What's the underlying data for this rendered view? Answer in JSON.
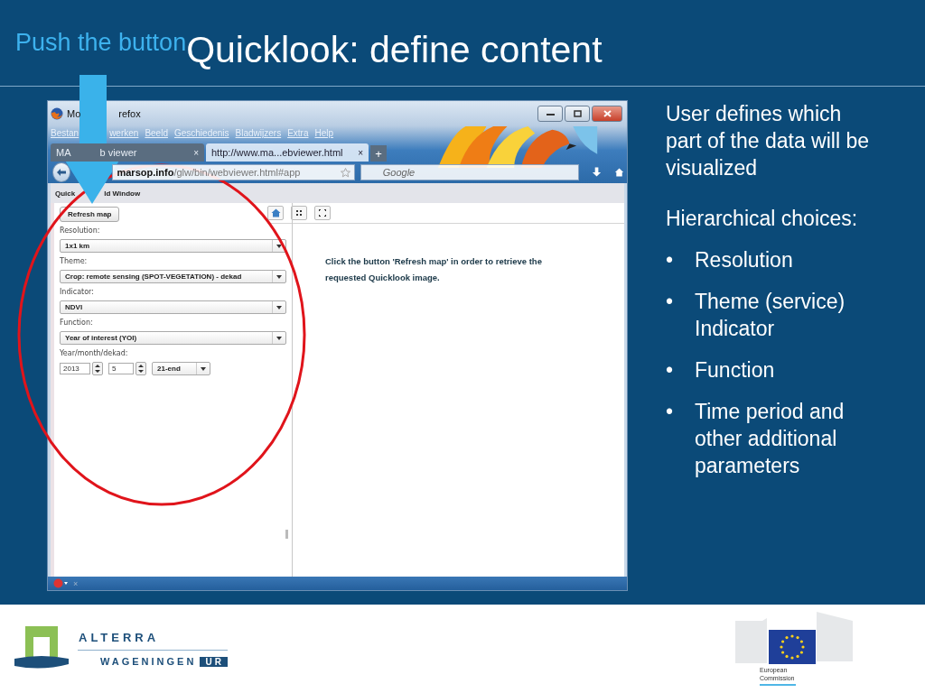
{
  "slide": {
    "tag": "Push the button",
    "title": "Quicklook: define content"
  },
  "browser": {
    "title_parts": [
      "Mo",
      "refox"
    ],
    "menu": [
      "Bestan",
      "werken",
      "Beeld",
      "Geschiedenis",
      "Bladwijzers",
      "Extra",
      "Help"
    ],
    "tabs": [
      {
        "label_parts": [
          "MA",
          "b viewer"
        ],
        "selected": false,
        "close": "×"
      },
      {
        "label_parts": [
          "http://www.ma...ebviewer.html"
        ],
        "selected": true,
        "close": "×"
      }
    ],
    "new_tab": "+",
    "url": {
      "host": "marsop.info",
      "path": "/glw/bin/webviewer.html#app"
    },
    "search": {
      "placeholder": "Google"
    },
    "breadcrumb_parts": [
      "Quick",
      "ld Window"
    ]
  },
  "panel": {
    "controls": [
      {
        "kind": "button",
        "text": "Refresh map"
      },
      {
        "kind": "label",
        "text": "Resolution:"
      },
      {
        "kind": "select",
        "text": "1x1 km"
      },
      {
        "kind": "label",
        "text": "Theme:"
      },
      {
        "kind": "select",
        "text": "Crop: remote sensing (SPOT-VEGETATION) - dekad"
      },
      {
        "kind": "label",
        "text": "Indicator:"
      },
      {
        "kind": "select",
        "text": "NDVI"
      },
      {
        "kind": "label",
        "text": "Function:"
      },
      {
        "kind": "select",
        "text": "Year of interest (YOI)"
      },
      {
        "kind": "label",
        "text": "Year/month/dekad:"
      },
      {
        "kind": "date",
        "year": "2013",
        "month": "5",
        "dekad": "21-end"
      }
    ]
  },
  "message": "Click the button 'Refresh map' in order to retrieve the requested Quicklook image.",
  "status_bar": {
    "close": "×"
  },
  "notes": {
    "intro": "User defines which part of the data will be visualized",
    "heading": "Hierarchical choices:",
    "bullet_mark": "•",
    "bullets": [
      "Resolution",
      "Theme (service) Indicator",
      "Function",
      "Time period and other additional parameters"
    ]
  },
  "footer": {
    "alterra": "ALTERRA",
    "wageningen": "WAGENINGEN",
    "ur": "UR",
    "commission": "European Commission"
  }
}
